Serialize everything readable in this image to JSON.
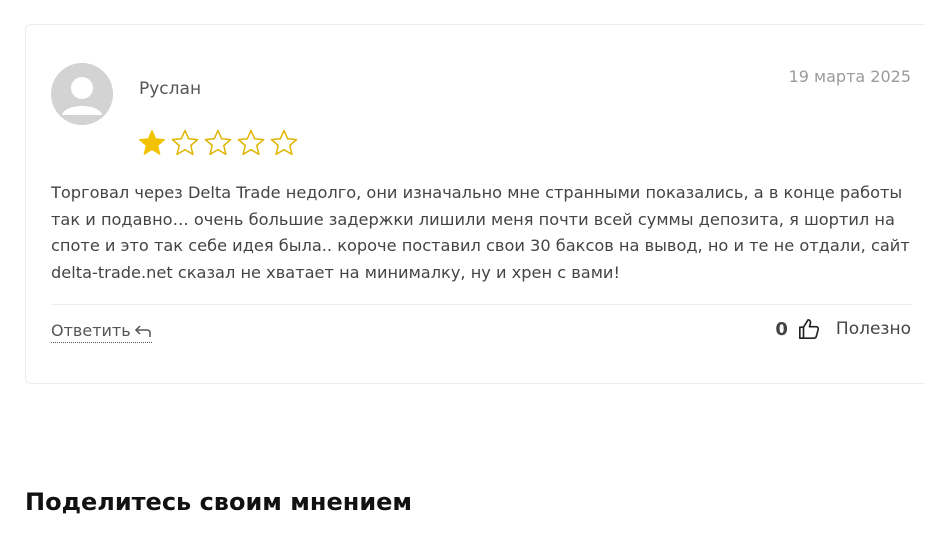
{
  "review": {
    "author": "Руслан",
    "date": "19 марта 2025",
    "rating": 1,
    "max_rating": 5,
    "text": "Торговал через Delta Trade недолго, они изначально мне странными показались, а в конце работы так и подавно… очень большие задержки лишили меня почти всей суммы депозита, я шортил на споте и это так себе идея была.. короче поставил свои 30 баксов на вывод, но и те не отдали, сайт delta-trade.net сказал не хватает на минималку, ну и хрен с вами!",
    "reply_label": "Ответить",
    "like_count": "0",
    "useful_label": "Полезно"
  },
  "share_section": {
    "title": "Поделитесь своим мнением"
  },
  "colors": {
    "star_filled": "#f2c200",
    "star_empty_stroke": "#e0b400",
    "avatar_bg": "#d3d3d3"
  },
  "icons": {
    "avatar": "user-avatar-icon",
    "reply": "reply-arrow-icon",
    "like": "thumbs-up-icon",
    "star": "star-icon"
  }
}
